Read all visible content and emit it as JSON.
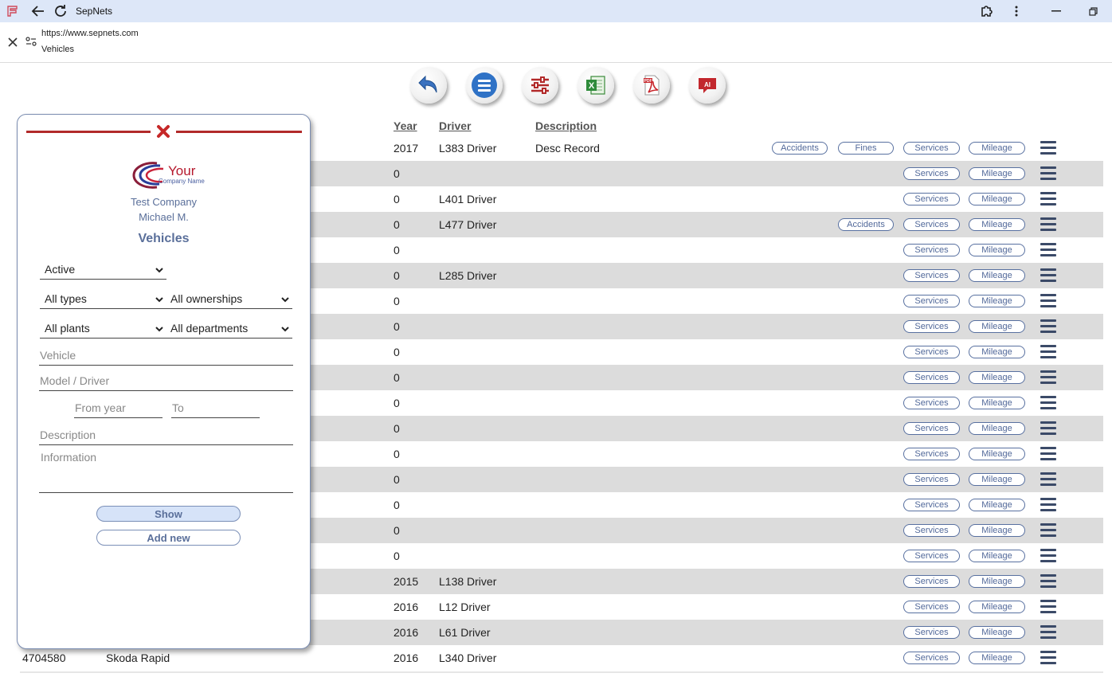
{
  "browser": {
    "title": "SepNets",
    "url": "https://www.sepnets.com",
    "page": "Vehicles"
  },
  "colors": {
    "accent": "#52699a",
    "danger": "#b22a2a",
    "row_alt": "#dcdcdc",
    "titlebar": "#dde7f8"
  },
  "toolbar": {
    "buttons": [
      {
        "name": "back",
        "icon": "back-arrow-icon"
      },
      {
        "name": "menu",
        "icon": "list-icon"
      },
      {
        "name": "filters",
        "icon": "sliders-icon"
      },
      {
        "name": "excel",
        "icon": "excel-icon"
      },
      {
        "name": "pdf",
        "icon": "pdf-icon"
      },
      {
        "name": "ai",
        "icon": "ai-chat-icon",
        "label": "AI"
      }
    ],
    "excel_label": "X",
    "pdf_label": "PDF"
  },
  "table": {
    "headers": {
      "year": "Year",
      "driver": "Driver",
      "description": "Description"
    },
    "labels": {
      "accidents": "Accidents",
      "fines": "Fines",
      "services": "Services",
      "mileage": "Mileage"
    },
    "rows": [
      {
        "vehicle": "",
        "model": "",
        "year": "2017",
        "driver": "L383 Driver",
        "description": "Desc Record",
        "accidents": true,
        "fines": true
      },
      {
        "vehicle": "",
        "model": "",
        "year": "0",
        "driver": "",
        "description": "",
        "accidents": false,
        "fines": false
      },
      {
        "vehicle": "",
        "model": "",
        "year": "0",
        "driver": "L401 Driver",
        "description": "",
        "accidents": false,
        "fines": false
      },
      {
        "vehicle": "",
        "model": "",
        "year": "0",
        "driver": "L477 Driver",
        "description": "",
        "accidents": true,
        "fines": false
      },
      {
        "vehicle": "",
        "model": "",
        "year": "0",
        "driver": "",
        "description": "",
        "accidents": false,
        "fines": false
      },
      {
        "vehicle": "",
        "model": "",
        "year": "0",
        "driver": "L285 Driver",
        "description": "",
        "accidents": false,
        "fines": false
      },
      {
        "vehicle": "",
        "model": "",
        "year": "0",
        "driver": "",
        "description": "",
        "accidents": false,
        "fines": false
      },
      {
        "vehicle": "",
        "model": "",
        "year": "0",
        "driver": "",
        "description": "",
        "accidents": false,
        "fines": false
      },
      {
        "vehicle": "",
        "model": "",
        "year": "0",
        "driver": "",
        "description": "",
        "accidents": false,
        "fines": false
      },
      {
        "vehicle": "",
        "model": "",
        "year": "0",
        "driver": "",
        "description": "",
        "accidents": false,
        "fines": false
      },
      {
        "vehicle": "",
        "model": "",
        "year": "0",
        "driver": "",
        "description": "",
        "accidents": false,
        "fines": false
      },
      {
        "vehicle": "",
        "model": "",
        "year": "0",
        "driver": "",
        "description": "",
        "accidents": false,
        "fines": false
      },
      {
        "vehicle": "",
        "model": "",
        "year": "0",
        "driver": "",
        "description": "",
        "accidents": false,
        "fines": false
      },
      {
        "vehicle": "",
        "model": "",
        "year": "0",
        "driver": "",
        "description": "",
        "accidents": false,
        "fines": false
      },
      {
        "vehicle": "",
        "model": "",
        "year": "0",
        "driver": "",
        "description": "",
        "accidents": false,
        "fines": false
      },
      {
        "vehicle": "",
        "model": "",
        "year": "0",
        "driver": "",
        "description": "",
        "accidents": false,
        "fines": false
      },
      {
        "vehicle": "",
        "model": "",
        "year": "0",
        "driver": "",
        "description": "",
        "accidents": false,
        "fines": false
      },
      {
        "vehicle": "",
        "model": "",
        "year": "2015",
        "driver": "L138 Driver",
        "description": "",
        "accidents": false,
        "fines": false
      },
      {
        "vehicle": "",
        "model": "",
        "year": "2016",
        "driver": "L12 Driver",
        "description": "",
        "accidents": false,
        "fines": false
      },
      {
        "vehicle": "",
        "model": "",
        "year": "2016",
        "driver": "L61 Driver",
        "description": "",
        "accidents": false,
        "fines": false
      },
      {
        "vehicle": "4704580",
        "model": "Skoda Rapid",
        "year": "2016",
        "driver": "L340 Driver",
        "description": "",
        "accidents": false,
        "fines": false
      }
    ]
  },
  "filter_panel": {
    "logo_text": "Your",
    "logo_sub": "Company Name",
    "company": "Test Company",
    "user": "Michael M.",
    "heading": "Vehicles",
    "status": "Active",
    "types": "All types",
    "ownerships": "All ownerships",
    "plants": "All plants",
    "departments": "All departments",
    "vehicle_placeholder": "Vehicle",
    "model_placeholder": "Model / Driver",
    "from_year_placeholder": "From year",
    "to_placeholder": "To",
    "description_placeholder": "Description",
    "information_placeholder": "Information",
    "show_label": "Show",
    "add_new_label": "Add new"
  }
}
